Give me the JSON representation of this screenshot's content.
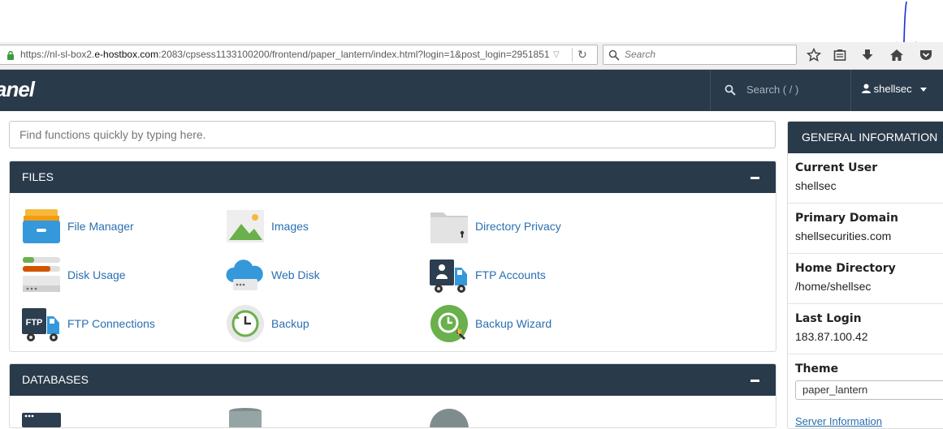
{
  "browser": {
    "url_prefix": "https://nl-sl-box2.",
    "url_host": "e-hostbox.com",
    "url_suffix": ":2083/cpsess1133100200/frontend/paper_lantern/index.html?login=1&post_login=2951851",
    "search_placeholder": "Search"
  },
  "header": {
    "logo": "anel",
    "search_placeholder": "Search ( / )",
    "username": "shellsec"
  },
  "quick_find": {
    "placeholder": "Find functions quickly by typing here."
  },
  "files": {
    "title": "FILES",
    "items": [
      {
        "label": "File Manager",
        "icon": "file-manager-icon"
      },
      {
        "label": "Images",
        "icon": "images-icon"
      },
      {
        "label": "Directory Privacy",
        "icon": "directory-privacy-icon"
      },
      {
        "label": "Disk Usage",
        "icon": "disk-usage-icon"
      },
      {
        "label": "Web Disk",
        "icon": "web-disk-icon"
      },
      {
        "label": "FTP Accounts",
        "icon": "ftp-accounts-icon"
      },
      {
        "label": "FTP Connections",
        "icon": "ftp-connections-icon"
      },
      {
        "label": "Backup",
        "icon": "backup-icon"
      },
      {
        "label": "Backup Wizard",
        "icon": "backup-wizard-icon"
      }
    ]
  },
  "databases": {
    "title": "DATABASES"
  },
  "general_info": {
    "title": "GENERAL INFORMATION",
    "current_user_label": "Current User",
    "current_user": "shellsec",
    "primary_domain_label": "Primary Domain",
    "primary_domain": "shellsecurities.com",
    "home_directory_label": "Home Directory",
    "home_directory": "/home/shellsec",
    "last_login_label": "Last Login",
    "last_login": "183.87.100.42",
    "theme_label": "Theme",
    "theme": "paper_lantern",
    "server_info_link": "Server Information"
  },
  "colors": {
    "header_bg": "#293a4a",
    "link": "#2a6fb0",
    "annotation": "#1a2fd6"
  }
}
